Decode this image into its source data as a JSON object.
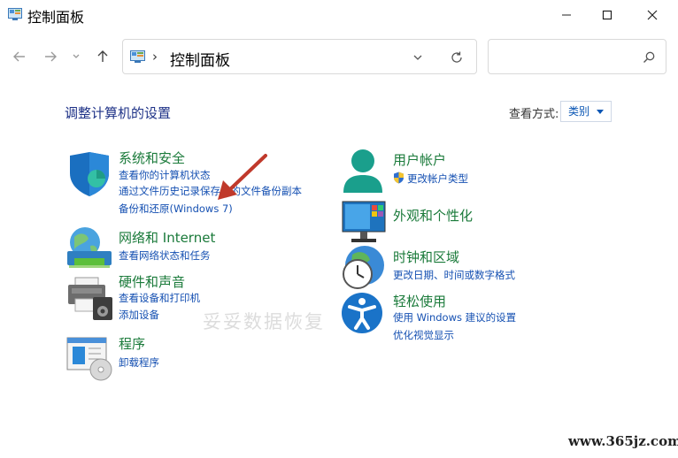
{
  "window": {
    "title": "控制面板",
    "icon": "control-panel-icon"
  },
  "address_bar": {
    "path": "控制面板",
    "separator": "›"
  },
  "search": {
    "placeholder": ""
  },
  "header": {
    "title": "调整计算机的设置",
    "view_by_label": "查看方式:",
    "view_by_value": "类别"
  },
  "categories_left": [
    {
      "id": "system-security",
      "title": "系统和安全",
      "icon": "shield-icon",
      "links": [
        "查看你的计算机状态",
        "通过文件历史记录保存你的文件备份副本",
        "备份和还原(Windows 7)"
      ]
    },
    {
      "id": "network",
      "title": "网络和 Internet",
      "icon": "network-globe-icon",
      "links": [
        "查看网络状态和任务"
      ]
    },
    {
      "id": "hardware",
      "title": "硬件和声音",
      "icon": "printer-speaker-icon",
      "links": [
        "查看设备和打印机",
        "添加设备"
      ]
    },
    {
      "id": "programs",
      "title": "程序",
      "icon": "programs-disc-icon",
      "links": [
        "卸载程序"
      ]
    }
  ],
  "categories_right": [
    {
      "id": "user-accounts",
      "title": "用户帐户",
      "icon": "user-icon",
      "links": [
        "更改帐户类型"
      ]
    },
    {
      "id": "appearance",
      "title": "外观和个性化",
      "icon": "monitor-icon",
      "links": []
    },
    {
      "id": "clock-region",
      "title": "时钟和区域",
      "icon": "clock-globe-icon",
      "links": [
        "更改日期、时间或数字格式"
      ]
    },
    {
      "id": "ease-of-access",
      "title": "轻松使用",
      "icon": "accessibility-icon",
      "links": [
        "使用 Windows 建议的设置",
        "优化视觉显示"
      ]
    }
  ],
  "watermark": "妥妥数据恢复",
  "site_watermark": "www.365jz.com",
  "colors": {
    "title_blue": "#1e3287",
    "category_green": "#1a7a3a",
    "link_blue": "#1550b2",
    "arrow_red": "#c0392b"
  }
}
